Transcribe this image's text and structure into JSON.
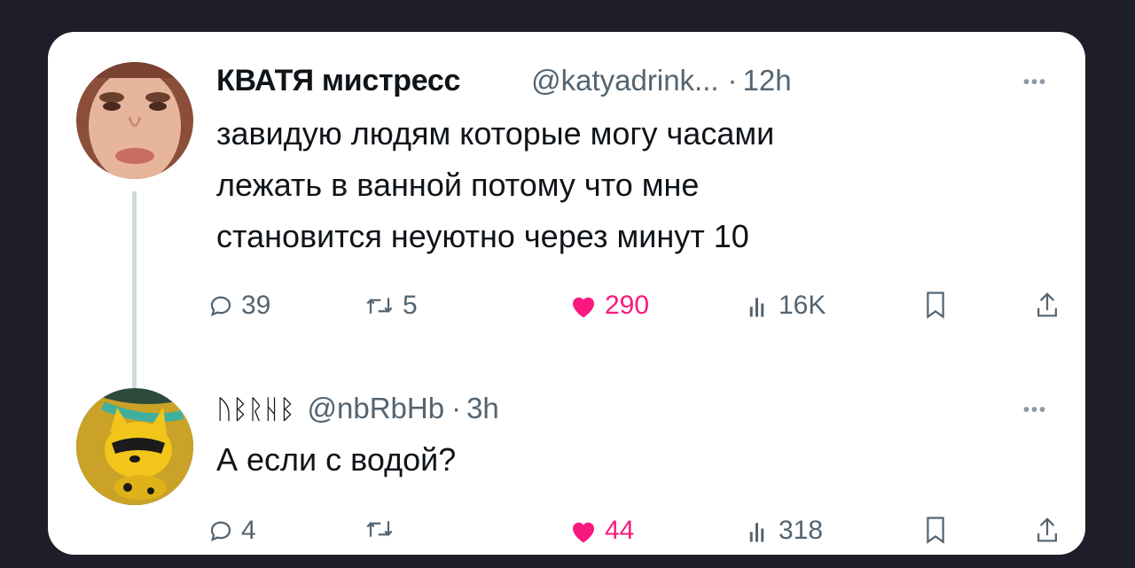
{
  "tweet": {
    "display_name": "КВАТЯ мистресс",
    "handle": "@katyadrink...",
    "time": "12h",
    "text_lines": [
      "завидую людям которые могу часами",
      "лежать в ванной потому что мне",
      "становится неуютно через минут 10"
    ],
    "stats": {
      "replies": "39",
      "reposts": "5",
      "likes": "290",
      "views": "16K"
    },
    "liked": true
  },
  "reply": {
    "display_name": "ᚢᛒᚱᚺᛒ",
    "handle": "@nbRbHb",
    "time": "3h",
    "text": "А если с водой?",
    "stats": {
      "replies": "4",
      "reposts": "",
      "likes": "44",
      "views": "318"
    },
    "liked": true
  },
  "separator": "·",
  "more_label": "•••",
  "colors": {
    "background": "#1d1e29",
    "card": "#ffffff",
    "text": "#0f1419",
    "secondary": "#536471",
    "like": "#f91880",
    "thread_line": "#cfd9de"
  },
  "icons": [
    "reply-icon",
    "repost-icon",
    "heart-icon",
    "views-icon",
    "bookmark-icon",
    "share-icon",
    "more-icon"
  ]
}
